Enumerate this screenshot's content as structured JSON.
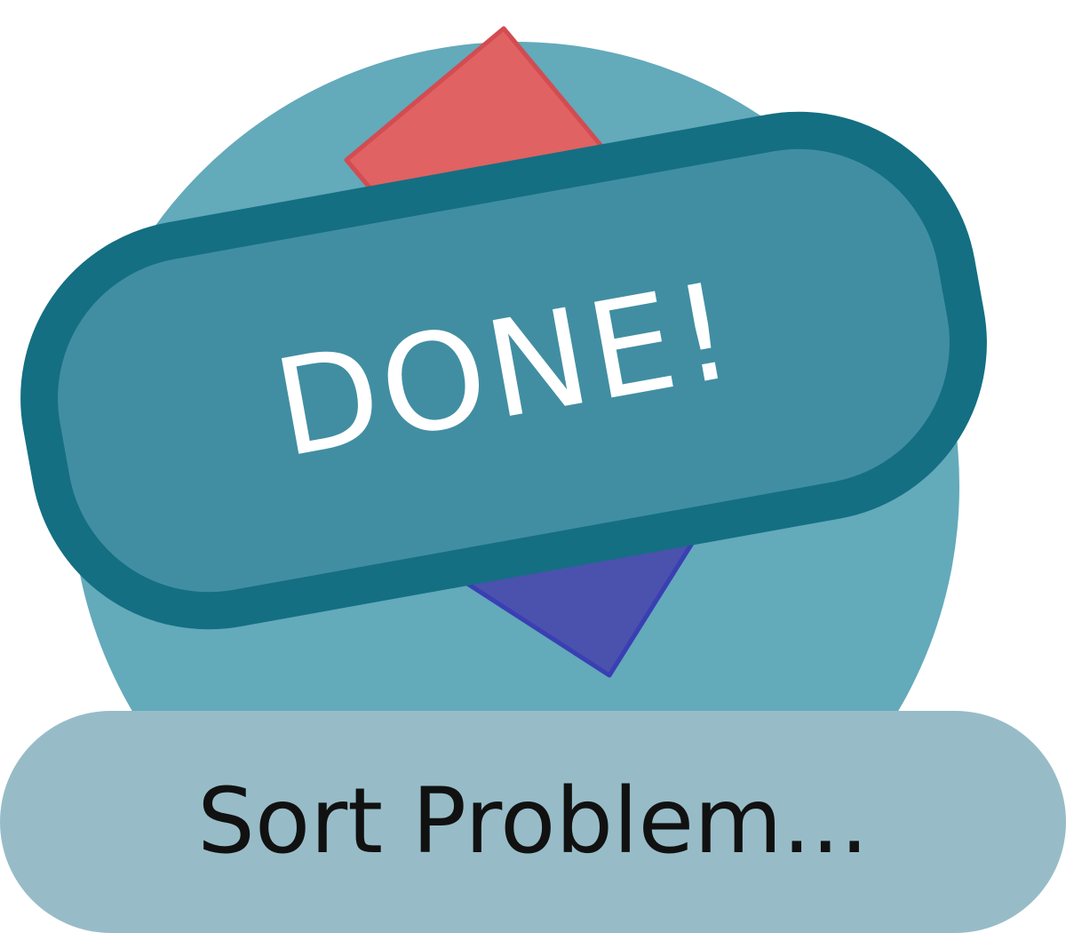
{
  "badge": {
    "label": "DONE!"
  },
  "caption": {
    "text": "Sort Problem..."
  },
  "colors": {
    "circle": "#63aabb",
    "badge_fill": "#418ea2",
    "badge_border": "#146f82",
    "red_shape": "#e06262",
    "blue_shape": "#4a52ad",
    "caption_pill": "#97bcc8",
    "label_text": "#ffffff",
    "caption_text": "#111111"
  },
  "icons": {
    "background": "circle-shape",
    "top": "red-diamond-shape",
    "bottom": "blue-triangle-shape"
  }
}
